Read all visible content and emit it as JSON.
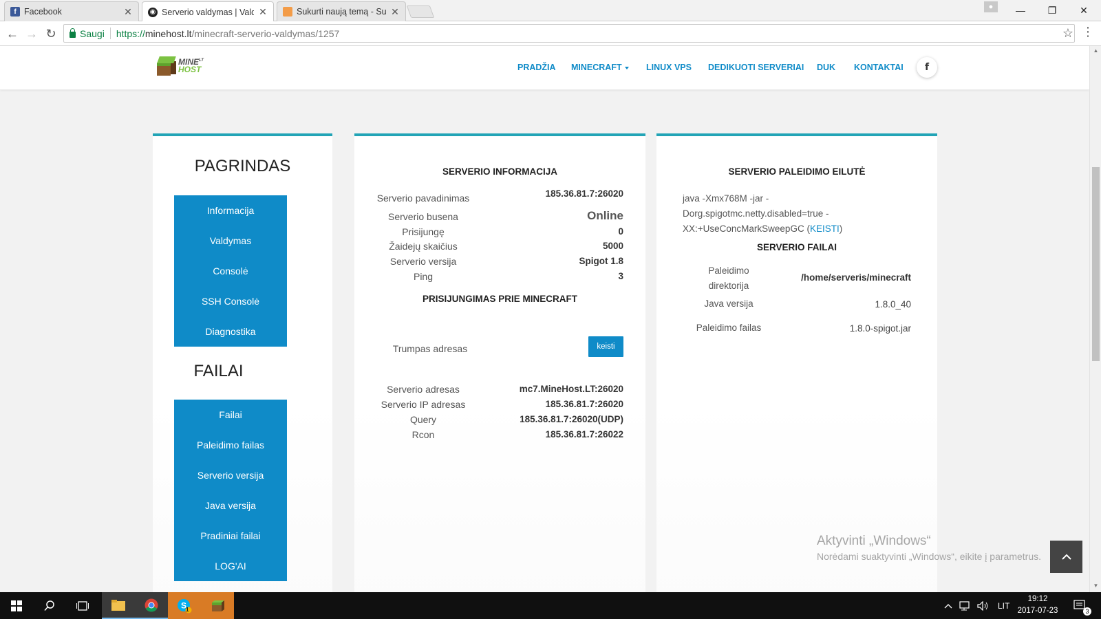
{
  "browser": {
    "tabs": [
      {
        "title": "Facebook",
        "favicon": "facebook-icon",
        "active": false
      },
      {
        "title": "Serverio valdymas | Valdy",
        "favicon": "minehost-icon",
        "active": true
      },
      {
        "title": "Sukurti naują temą - Sup",
        "favicon": "forum-icon",
        "active": false
      }
    ],
    "security_label": "Saugi",
    "url_protocol": "https://",
    "url_domain": "minehost.lt",
    "url_path": "/minecraft-serverio-valdymas/1257"
  },
  "site": {
    "logo_word": "MINE",
    "logo_sup": "LT",
    "logo_host": "HOST",
    "nav": [
      "PRADŽIA",
      "MINECRAFT",
      "LINUX VPS",
      "DEDIKUOTI SERVERIAI",
      "DUK",
      "KONTAKTAI"
    ],
    "facebook_glyph": "f"
  },
  "sidebar": {
    "heading_main": "PAGRINDAS",
    "main_items": [
      "Informacija",
      "Valdymas",
      "Consolė",
      "SSH Consolė",
      "Diagnostika"
    ],
    "heading_files": "FAILAI",
    "file_items": [
      "Failai",
      "Paleidimo failas",
      "Serverio versija",
      "Java versija",
      "Pradiniai failai",
      "LOG'AI"
    ]
  },
  "server_info": {
    "title": "SERVERIO INFORMACIJA",
    "rows": [
      {
        "label": "Serverio pavadinimas",
        "value": "185.36.81.7:26020"
      },
      {
        "label": "Serverio busena",
        "value": "Online"
      },
      {
        "label": "Prisijungę",
        "value": "0"
      },
      {
        "label": "Žaidejų skaičius",
        "value": "5000"
      },
      {
        "label": "Serverio versija",
        "value": "Spigot 1.8"
      },
      {
        "label": "Ping",
        "value": "3"
      }
    ],
    "connect_title": "PRISIJUNGIMAS PRIE MINECRAFT",
    "short_address_label": "Trumpas adresas",
    "change_button": "keisti",
    "addresses": [
      {
        "label": "Serverio adresas",
        "value": "mc7.MineHost.LT:26020"
      },
      {
        "label": "Serverio IP adresas",
        "value": "185.36.81.7:26020"
      },
      {
        "label": "Query",
        "value": "185.36.81.7:26020(UDP)"
      },
      {
        "label": "Rcon",
        "value": "185.36.81.7:26022"
      }
    ]
  },
  "startup": {
    "title": "SERVERIO PALEIDIMO EILUTĖ",
    "line1": "java -Xmx768M -jar -",
    "line2": "Dorg.spigotmc.netty.disabled=true -",
    "line3": "XX:+UseConcMarkSweepGC (",
    "link": "KEISTI",
    "line3_end": ")",
    "files_title": "SERVERIO FAILAI",
    "files": [
      {
        "label": "Paleidimo direktorija",
        "value": "/home/serveris/minecraft"
      },
      {
        "label": "Java versija",
        "value": "1.8.0_40"
      },
      {
        "label": "Paleidimo failas",
        "value": "1.8.0-spigot.jar"
      }
    ]
  },
  "watermark": {
    "line1": "Aktyvinti „Windows“",
    "line2": "Norėdami suaktyvinti „Windows“, eikite į parametrus."
  },
  "taskbar": {
    "language": "LIT",
    "time": "19:12",
    "date": "2017-07-23",
    "notification_count": "3",
    "skype_badge": "1"
  }
}
